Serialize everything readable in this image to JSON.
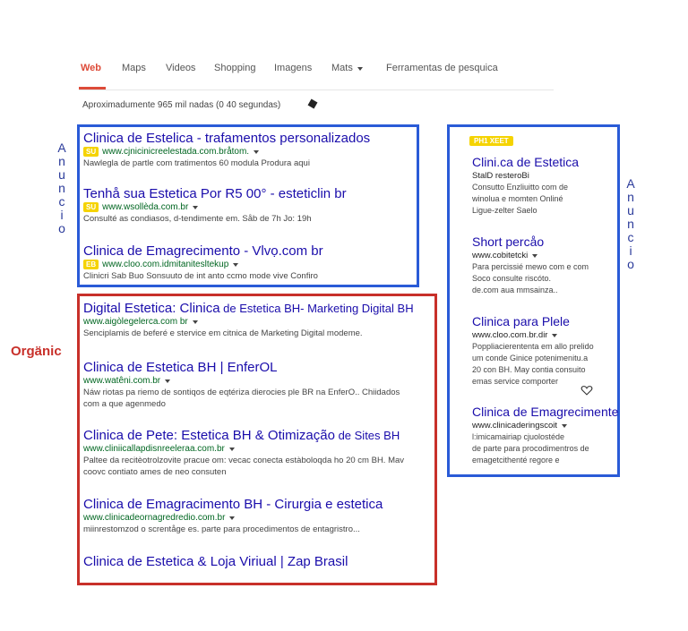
{
  "nav": {
    "tabs": [
      "Web",
      "Maps",
      "Videos",
      "Shopping",
      "Imagens",
      "Mats",
      "Ferramentas de pesquica"
    ],
    "active": "Web"
  },
  "result_stats": "Aproximadumente 965 mil nadas (0 40 segundas)",
  "labels": {
    "anuncio_left": [
      "A",
      "n",
      "u",
      "n",
      "c",
      "i",
      "o"
    ],
    "anuncio_right": [
      "A",
      "n",
      "u",
      "n",
      "c",
      "i",
      "o"
    ],
    "organic": "Orgänic"
  },
  "ads": [
    {
      "title": "Clinica de Estelica - trafamentos personalizados",
      "badge": "SU",
      "url": "www.cjnicinicreelestada.com.bråtom.",
      "desc": "Nawlegla de partle com tratimentos 60 modula Produra aqui"
    },
    {
      "title": "Tenhå sua Estetica Por R5 00° - esteticlin br",
      "badge": "SU",
      "url": "www.wsollèda.com.br",
      "desc": "Consulté as condiasos, d-tendimente em. Såb de 7h Jo: 19h"
    },
    {
      "title": "Clinica de Emagrecimento - Vlvọ.com br",
      "badge": "EB",
      "url": "www.cloo.com.idmitanitesltekup",
      "desc": "Clinicri Sab Buo Sonsuuto de int anto ccmo mode vive  Confiro"
    }
  ],
  "organic": [
    {
      "title_a": "Digital Estetica: Clinica",
      "title_b": " de Estetica BH- Marketing Digital BH",
      "url": "www.aigòlegelerca.com br",
      "desc": [
        "Senciplamis de beferé e stervice em citnica de Marketing Digital modeme."
      ]
    },
    {
      "title_a": "Clinica de Estetica BH | EnferOL",
      "title_b": "",
      "url": "www.watêni.com.br",
      "desc": [
        "Náw riotas pa riemo de sontiqos de eqtériza dierocies ple BR na EnferO.. Chiidados",
        "com a que agenmedo"
      ]
    },
    {
      "title_a": "Clinica de Pete: Estetica BH & Otimização",
      "title_b": " de Sites BH",
      "url": "www.cliniicallapdisnreeleraa.com.br",
      "desc": [
        "Paltee da  recitèotrolzovite pracue om: vecac conecta estàboloqda ho 20 cm BH. Mav",
        "coovc contiato ames de neo consuten"
      ]
    },
    {
      "title_a": "Clinica de Emagracimento BH - Cirurgia e estetica",
      "title_b": "",
      "url": "www.clinicadeornagredredio.com.br",
      "desc": [
        "miinrestomzod o screntåge es. parte para procedimentos de entagristro..."
      ]
    },
    {
      "title_a": "Clinica de Estetica & Loja Viriual | Zap Brasil",
      "title_b": "",
      "url": "",
      "desc": []
    }
  ],
  "side_badge": "PH1 XEET",
  "side_ads": [
    {
      "title": "Clini.ca de Estetica",
      "url": "StalD resteroBi",
      "desc": [
        "Consutto Enzliuitto com de",
        "winolua e momten Onliné",
        "Ligue-zelter Saelo"
      ]
    },
    {
      "title": "Short percåo",
      "url": "www.cobitetcki",
      "desc": [
        "Para percissié mewo com e com",
        "Soco consulte riscóto.",
        "de.com aua mmsainza.."
      ]
    },
    {
      "title": "Clinica para Plele",
      "url": "www.cloo.com.br.dir",
      "desc": [
        "Poppliacierententa em allo prelido",
        "um conde Ginice potenimenitu.a",
        "20 con BH. May contia consuito",
        "emas service comporter"
      ]
    },
    {
      "title": "Clinica de Emagrecimente",
      "url": "www.clinicaderingscoit",
      "desc": [
        "l:imicamairiap cjuolostéde",
        "de parte para procodimentros de",
        "emagetcithenté regore e"
      ]
    }
  ],
  "colors": {
    "ad_box": "#2a5bd7",
    "organic_box": "#c8302a",
    "link": "#1a0dab",
    "url": "#006621",
    "badge": "#f5d300",
    "active_tab": "#dd4b39"
  }
}
